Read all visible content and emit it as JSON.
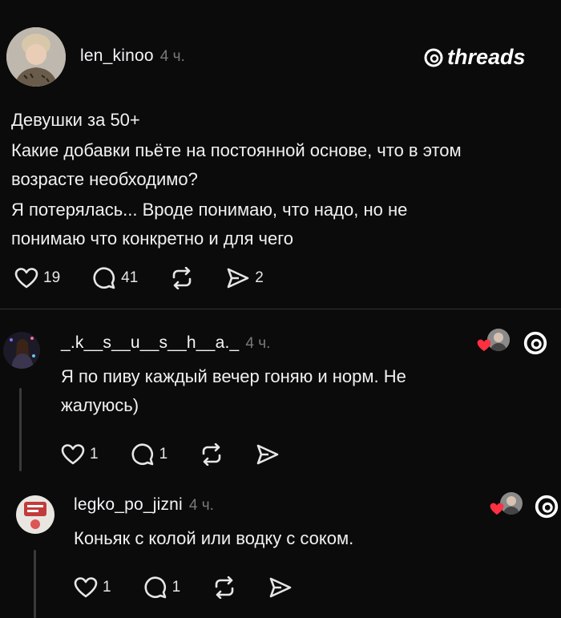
{
  "post": {
    "username": "len_kinoo",
    "time": "4 ч.",
    "brand": "threads",
    "lines": [
      "Девушки за 50+",
      "Какие добавки пьёте на постоянной основе, что в этом",
      "возрасте необходимо?",
      "Я потерялась... Вроде понимаю, что надо, но не",
      "понимаю что конкретно и для чего"
    ],
    "likes": "19",
    "replies": "41",
    "shares": "2"
  },
  "reply1": {
    "username": "_.k__s__u__s__h__a._",
    "time": "4 ч.",
    "lines": [
      "Я по пиву каждый вечер гоняю и норм. Не",
      "жалуюсь)"
    ],
    "likes": "1",
    "replies": "1"
  },
  "reply2": {
    "username": "legko_po_jizni",
    "time": "4 ч.",
    "lines": [
      "Коньяк с колой или водку с соком."
    ],
    "likes": "1",
    "replies": "1"
  },
  "colors": {
    "background": "#0b0b0b",
    "text": "#f3f5f7",
    "muted": "#7a7a7a",
    "heart": "#ff3040"
  }
}
